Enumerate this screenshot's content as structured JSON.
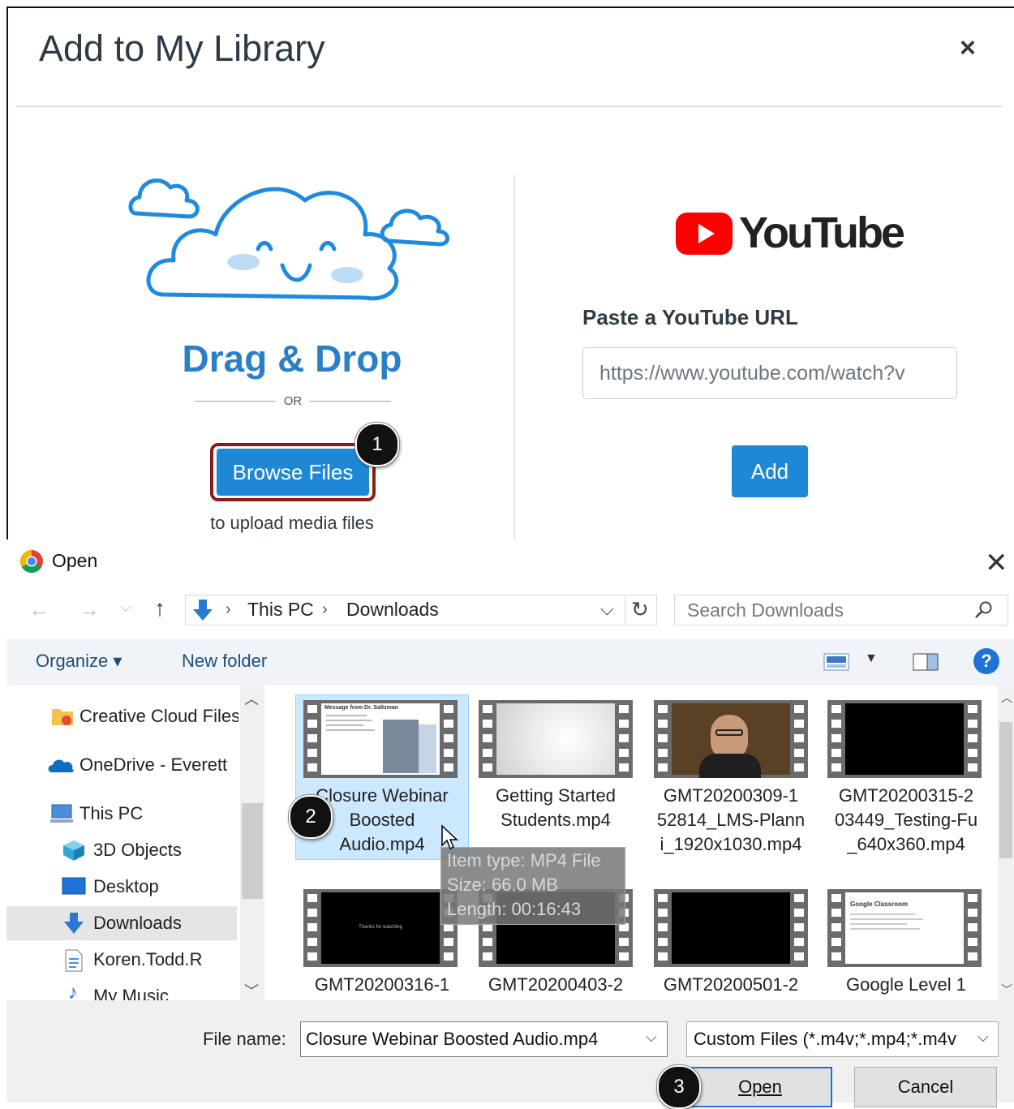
{
  "library": {
    "title": "Add to My Library",
    "close": "×",
    "drag_drop": "Drag & Drop",
    "or": "OR",
    "browse": "Browse Files",
    "upload_hint": "to upload media files",
    "youtube_logo_text": "YouTube",
    "youtube_label": "Paste a YouTube URL",
    "youtube_placeholder": "https://www.youtube.com/watch?v",
    "add": "Add"
  },
  "steps": [
    "1",
    "2",
    "3"
  ],
  "dialog": {
    "title": "Open",
    "close": "✕",
    "breadcrumb": [
      "This PC",
      "Downloads"
    ],
    "search_placeholder": "Search Downloads",
    "organize": "Organize ▾",
    "new_folder": "New folder",
    "help": "?",
    "sidebar": [
      {
        "label": "Creative Cloud Files",
        "icon": "creative-cloud-icon"
      },
      {
        "label": "OneDrive - Everett",
        "icon": "onedrive-icon"
      },
      {
        "label": "This PC",
        "icon": "pc-icon"
      },
      {
        "label": "3D Objects",
        "icon": "3d-objects-icon"
      },
      {
        "label": "Desktop",
        "icon": "desktop-icon"
      },
      {
        "label": "Downloads",
        "icon": "downloads-icon"
      },
      {
        "label": "Koren.Todd.R",
        "icon": "file-icon"
      },
      {
        "label": "My Music",
        "icon": "music-icon"
      }
    ],
    "files": [
      {
        "name": [
          "Closure Webinar",
          "Boosted",
          "Audio.mp4"
        ],
        "thumb_slide_title": "Message from Dr. Saltzman"
      },
      {
        "name": [
          "Getting Started",
          "Students.mp4"
        ]
      },
      {
        "name": [
          "GMT20200309-1",
          "52814_LMS-Plann",
          "i_1920x1030.mp4"
        ]
      },
      {
        "name": [
          "GMT20200315-2",
          "03449_Testing-Fu",
          "_640x360.mp4"
        ]
      },
      {
        "name": [
          "GMT20200316-1"
        ],
        "thumb_text": "Thanks for watching"
      },
      {
        "name": [
          "GMT20200403-2"
        ]
      },
      {
        "name": [
          "GMT20200501-2"
        ]
      },
      {
        "name": [
          "Google Level 1"
        ],
        "thumb_slide_title": "Google Classroom"
      }
    ],
    "tooltip": [
      "Item type: MP4 File",
      "Size: 66.0 MB",
      "Length: 00:16:43"
    ],
    "file_name_label": "File name:",
    "file_name_value": "Closure Webinar Boosted Audio.mp4",
    "file_type_value": "Custom Files (*.m4v;*.mp4;*.m4v",
    "open": "Open",
    "cancel": "Cancel"
  },
  "colors": {
    "accent": "#1e88d6",
    "outline": "#8b1a1a",
    "selection": "#cce8ff"
  }
}
